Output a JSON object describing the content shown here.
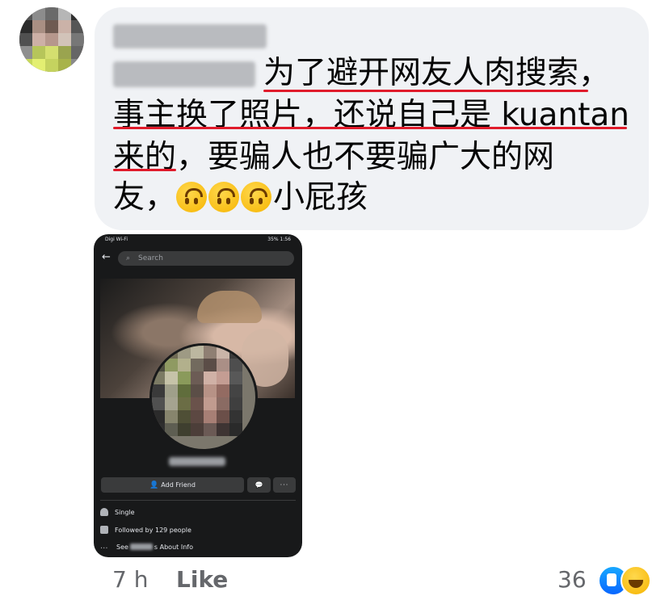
{
  "comment": {
    "lines": [
      "为了避开网友人肉搜索，",
      "事主换了照片，还说自己是 kuantan",
      "来的，要骗人也不要骗广大的网",
      "友，"
    ],
    "tail_text": "小屁孩",
    "emoji_names": [
      "upside-down-face-emoji",
      "upside-down-face-emoji",
      "upside-down-face-emoji"
    ]
  },
  "screenshot": {
    "status_left": "Digi Wi-Fi",
    "status_right": "35% 1:56",
    "search_placeholder": "Search",
    "add_friend_label": "Add Friend",
    "more_label": "···",
    "info": {
      "single": "Single",
      "followed": "Followed by 129 people",
      "see_prefix": "See",
      "see_suffix": "s About Info"
    }
  },
  "footer": {
    "time": "7 h",
    "like": "Like",
    "reaction_count": "36"
  },
  "colors": {
    "bubble_bg": "#f0f2f5",
    "underline": "#e01b2b",
    "meta_text": "#65676b"
  }
}
